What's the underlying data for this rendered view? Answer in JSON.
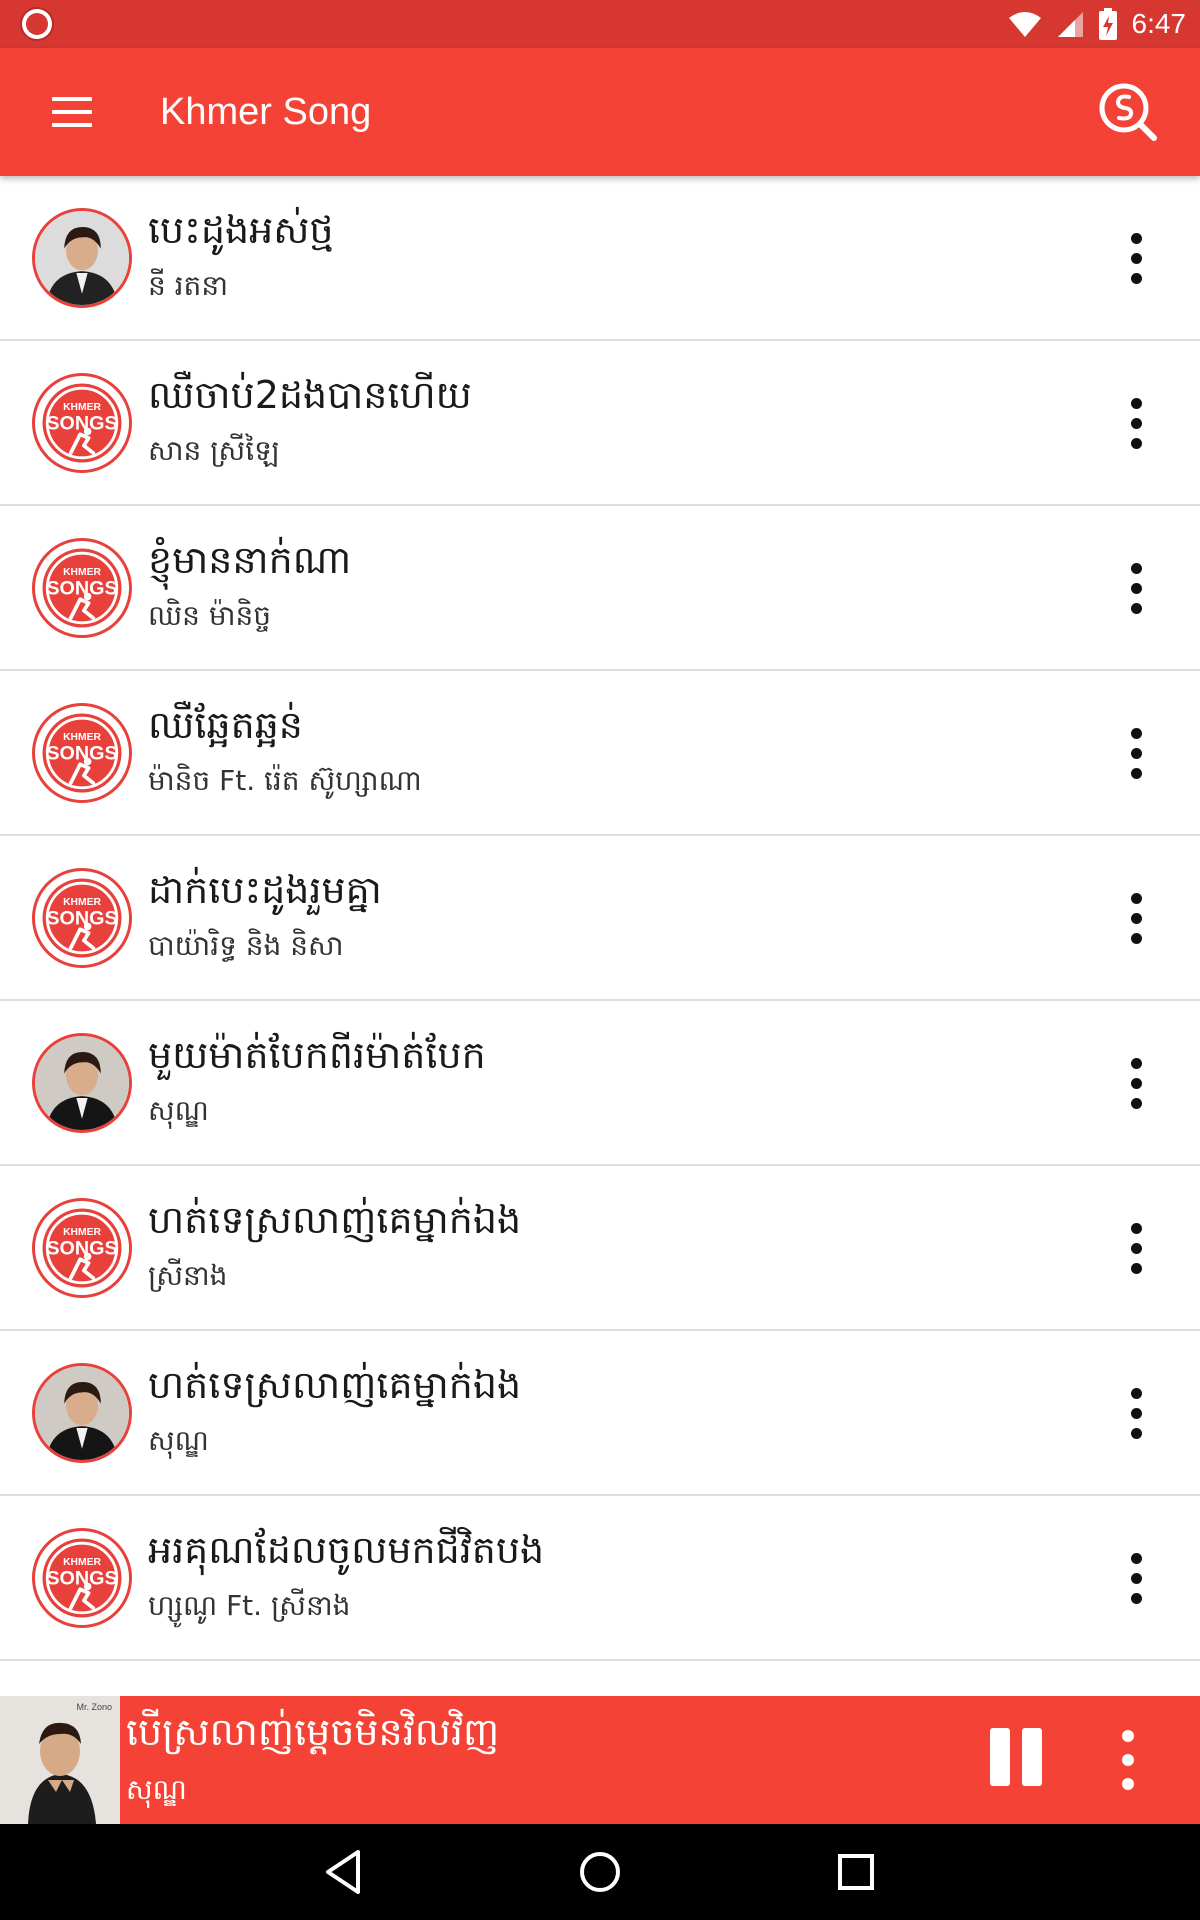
{
  "status_bar": {
    "time": "6:47"
  },
  "app_bar": {
    "title": "Khmer Song"
  },
  "songs": [
    {
      "title": "បេះដូងអស់ថ្ម",
      "artist": "នី រតនា",
      "avatar": "photo-singer-male-1"
    },
    {
      "title": "ឈឺចាប់2ដងបានហើយ",
      "artist": "សាន ស្រីឡៃ",
      "avatar": "khmer-songs-logo"
    },
    {
      "title": "ខ្ញុំមាននាក់ណា",
      "artist": "ឈិន ម៉ានិច្ច",
      "avatar": "khmer-songs-logo"
    },
    {
      "title": "ឈឺឆ្អែតឆ្អន់",
      "artist": "ម៉ានិច Ft. រ៉េត ស៊ូហ្សាណា",
      "avatar": "khmer-songs-logo"
    },
    {
      "title": "ដាក់បេះដូងរួមគ្នា",
      "artist": "បាយ៉ារិទ្ធ និង និសា",
      "avatar": "khmer-songs-logo"
    },
    {
      "title": "មួយម៉ាត់បែកពីរម៉ាត់បែក",
      "artist": "សុណ្ឌ",
      "avatar": "photo-singer-male-2"
    },
    {
      "title": "ហត់ទេស្រលាញ់គេម្នាក់ឯង",
      "artist": "ស្រីនាង",
      "avatar": "khmer-songs-logo"
    },
    {
      "title": "ហត់ទេស្រលាញ់គេម្នាក់ឯង",
      "artist": "សុណ្ឌ",
      "avatar": "photo-singer-male-2"
    },
    {
      "title": "អរគុណដែលចូលមកជីវិតបង",
      "artist": "ហ្សូណូ Ft. ស្រីនាង",
      "avatar": "khmer-songs-logo"
    }
  ],
  "now_playing": {
    "title": "បើស្រលាញ់ម្ដេចមិនវិលវិញ",
    "artist": "សុណ្ឌ",
    "art_caption": "Mr. Zono"
  },
  "logo_text": {
    "top": "KHMER",
    "bottom": "SONGS"
  },
  "colors": {
    "primary": "#f44336",
    "status": "#d63731",
    "divider": "#dedede"
  }
}
